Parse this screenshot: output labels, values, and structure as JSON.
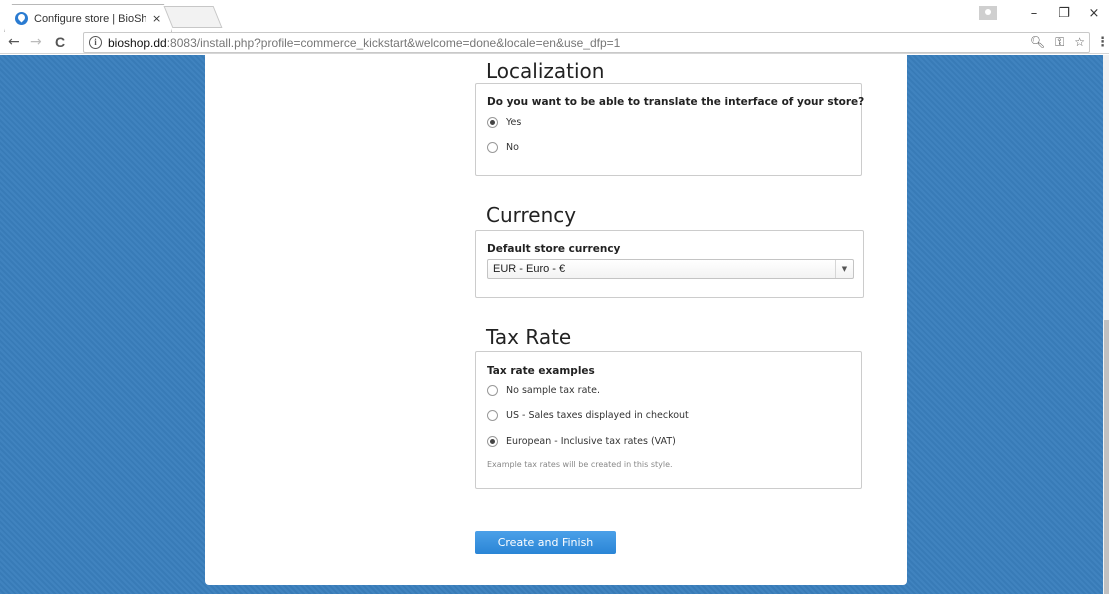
{
  "browser": {
    "tab_title": "Configure store | BioShop",
    "tab_close": "×",
    "url_host": "bioshop.dd",
    "url_rest": ":8083/install.php?profile=commerce_kickstart&welcome=done&locale=en&use_dfp=1",
    "window_controls": {
      "minimize": "–",
      "restore": "❐",
      "close": "×"
    },
    "nav": {
      "back": "←",
      "forward": "→",
      "reload": "C"
    },
    "icons": [
      "info-icon",
      "zoom-icon",
      "key-icon",
      "star-icon",
      "menu-icon"
    ]
  },
  "localization": {
    "title": "Localization",
    "question": "Do you want to be able to translate the interface of your store?",
    "options": [
      {
        "label": "Yes",
        "checked": true
      },
      {
        "label": "No",
        "checked": false
      }
    ]
  },
  "currency": {
    "title": "Currency",
    "label": "Default store currency",
    "selected": "EUR - Euro - €"
  },
  "tax": {
    "title": "Tax Rate",
    "label": "Tax rate examples",
    "options": [
      {
        "label": "No sample tax rate.",
        "checked": false
      },
      {
        "label": "US - Sales taxes displayed in checkout",
        "checked": false
      },
      {
        "label": "European - Inclusive tax rates (VAT)",
        "checked": true
      }
    ],
    "hint": "Example tax rates will be created in this style."
  },
  "submit_label": "Create and Finish",
  "colors": {
    "background": "#3a7fbd",
    "button": "#2a85d6",
    "panel": "#ffffff"
  }
}
